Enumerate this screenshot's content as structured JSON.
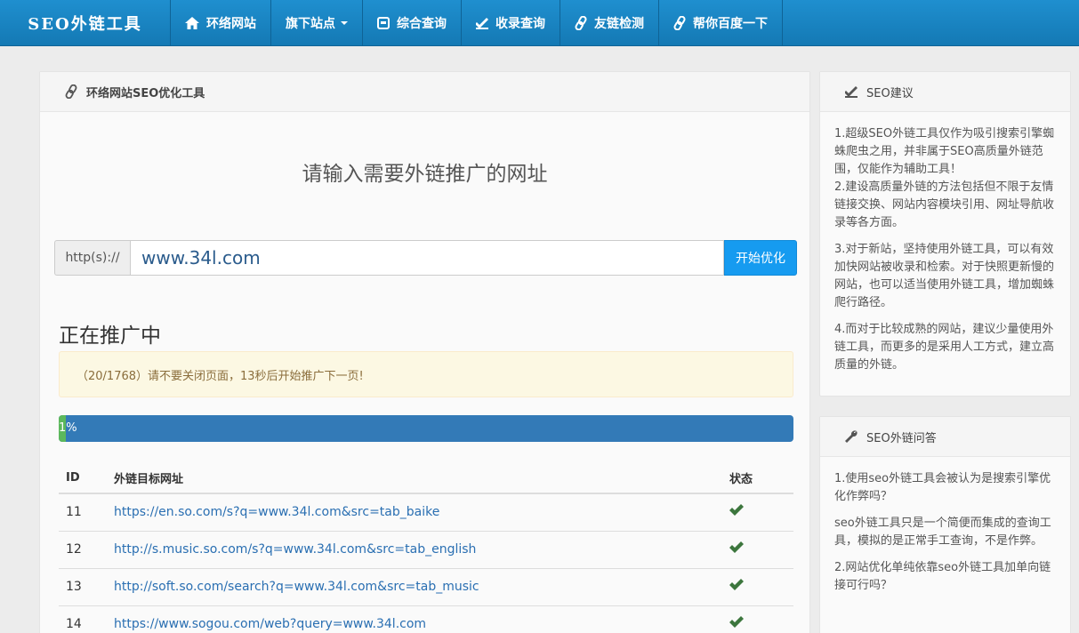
{
  "nav": {
    "brand": "SEO外链工具",
    "items": [
      {
        "label": "环络网站",
        "icon": "home-icon"
      },
      {
        "label": "旗下站点",
        "icon": "none",
        "dropdown": true
      },
      {
        "label": "综合查询",
        "icon": "monitor-icon"
      },
      {
        "label": "收录查询",
        "icon": "check-icon"
      },
      {
        "label": "友链检测",
        "icon": "link-icon"
      },
      {
        "label": "帮你百度一下",
        "icon": "link-icon"
      }
    ]
  },
  "main": {
    "title": "环络网站SEO优化工具",
    "prompt": "请输入需要外链推广的网址",
    "protocol": "http(s)://",
    "url_value": "www.34l.com",
    "submit_label": "开始优化",
    "status_title": "正在推广中",
    "alert": "（20/1768）请不要关闭页面，13秒后开始推广下一页!",
    "progress": {
      "label": "1%",
      "percent": 1
    },
    "table": {
      "headers": [
        "ID",
        "外链目标网址",
        "状态"
      ],
      "rows": [
        {
          "id": "11",
          "url": "https://en.so.com/s?q=www.34l.com&src=tab_baike"
        },
        {
          "id": "12",
          "url": "http://s.music.so.com/s?q=www.34l.com&src=tab_english"
        },
        {
          "id": "13",
          "url": "http://soft.so.com/search?q=www.34l.com&src=tab_music"
        },
        {
          "id": "14",
          "url": "https://www.sogou.com/web?query=www.34l.com"
        }
      ]
    }
  },
  "sidebar": {
    "advice_title": "SEO建议",
    "advice": [
      "1.超级SEO外链工具仅作为吸引搜索引擎蜘蛛爬虫之用，并非属于SEO高质量外链范围，仅能作为辅助工具！\n2.建设高质量外链的方法包括但不限于友情链接交换、网站内容模块引用、网址导航收录等各方面。",
      "3.对于新站，坚持使用外链工具，可以有效加快网站被收录和检索。对于快照更新慢的网站，也可以适当使用外链工具，增加蜘蛛爬行路径。",
      "4.而对于比较成熟的网站，建议少量使用外链工具，而更多的是采用人工方式，建立高质量的外链。"
    ],
    "faq_title": "SEO外链问答",
    "faq": [
      "1.使用seo外链工具会被认为是搜索引擎优化作弊吗？",
      "seo外链工具只是一个简便而集成的查询工具，模拟的是正常手工查询，不是作弊。",
      "2.网站优化单纯依靠seo外链工具加单向链接可行吗？"
    ]
  },
  "colors": {
    "nav": "#1a86c6",
    "button": "#169bf0",
    "progress": "#337ab7",
    "progress_fill": "#5cb85c",
    "check": "#3c763d"
  }
}
